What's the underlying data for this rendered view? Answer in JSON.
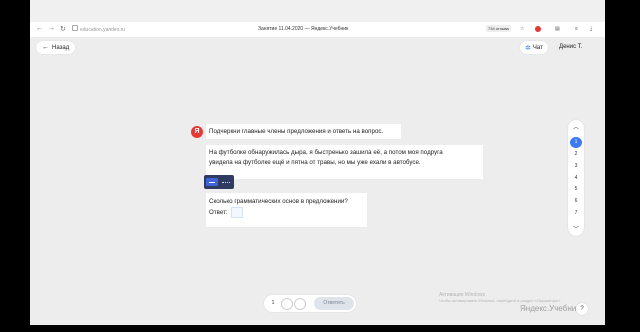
{
  "browser": {
    "url": "education.yandex.ru",
    "tab_title": "Занятие 11.04.2020 — Яндекс.Учебник",
    "ext_badge": "734 отзыва"
  },
  "header": {
    "back_label": "Назад",
    "chat_label": "Чат",
    "user_name": "Денис Т."
  },
  "task": {
    "instruction": "Подчеркни главные члены предложения и ответь на вопрос.",
    "passage_line1": "На футболке обнаружилась дыра, я быстренько зашила её, а потом моя подруга",
    "passage_line2": "увидела на футболке ещё и пятна от травы, но мы уже ехали в автобусе.",
    "question": "Сколько грамматических основ в предложении?",
    "answer_label": "Ответ:"
  },
  "stepper": {
    "steps": [
      "1",
      "2",
      "3",
      "4",
      "5",
      "6",
      "7"
    ],
    "current": 1
  },
  "footer": {
    "page_current": "1",
    "submit_label": "Ответить",
    "watermark_line1": "Активация Windows",
    "watermark_line2": "Чтобы активировать Windows, перейдите в раздел «Параметры».",
    "brand": "Яндекс.Учебник",
    "help": "?"
  },
  "colors": {
    "accent": "#3d7bf2",
    "toolbar": "#2f3b60",
    "logo": "#e53935"
  }
}
